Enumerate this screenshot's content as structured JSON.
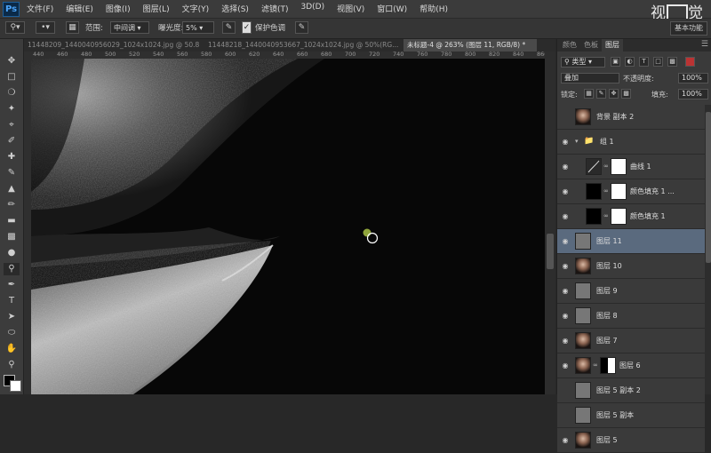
{
  "menubar": {
    "logo": "Ps",
    "items": [
      "文件(F)",
      "编辑(E)",
      "图像(I)",
      "图层(L)",
      "文字(Y)",
      "选择(S)",
      "滤镜(T)",
      "3D(D)",
      "视图(V)",
      "窗口(W)",
      "帮助(H)"
    ],
    "watermark_left": "视",
    "watermark_right": "觉"
  },
  "options": {
    "range_label": "范围:",
    "range_value": "中间调",
    "exposure_label": "曝光度:",
    "exposure_value": "5%",
    "protect_label": "保护色调",
    "workspace": "基本功能"
  },
  "tabs": [
    {
      "label": "11448209_1440040956029_1024x1024.jpg @ 50.8%..."
    },
    {
      "label": "11448218_1440040953667_1024x1024.jpg @ 50%(RG..."
    },
    {
      "label": "未标题-4 @ 263% (图层 11, RGB/8) *"
    }
  ],
  "ruler": [
    "440",
    "460",
    "480",
    "500",
    "520",
    "540",
    "560",
    "580",
    "600",
    "620",
    "640",
    "660",
    "680",
    "700",
    "720",
    "740",
    "760",
    "780",
    "800",
    "820",
    "840",
    "860"
  ],
  "panel": {
    "tabs": [
      "颜色",
      "色板",
      "图层"
    ],
    "filter_kind": "类型",
    "blend_mode": "叠加",
    "opacity_label": "不透明度:",
    "opacity_value": "100%",
    "lock_label": "锁定:",
    "fill_label": "填充:",
    "fill_value": "100%"
  },
  "layers": [
    {
      "name": "背景 副本 2",
      "visible": false,
      "thumb": "face",
      "mask": false,
      "indent": 0,
      "selected": false
    },
    {
      "name": "组 1",
      "visible": true,
      "thumb": "folder",
      "mask": false,
      "indent": 0,
      "selected": false
    },
    {
      "name": "曲线 1",
      "visible": true,
      "thumb": "curves",
      "mask": true,
      "indent": 1,
      "selected": false
    },
    {
      "name": "颜色填充 1 ...",
      "visible": true,
      "thumb": "black",
      "mask": true,
      "indent": 1,
      "selected": false
    },
    {
      "name": "颜色填充 1",
      "visible": true,
      "thumb": "black",
      "mask": true,
      "indent": 1,
      "selected": false
    },
    {
      "name": "图层 11",
      "visible": true,
      "thumb": "gray",
      "mask": false,
      "indent": 0,
      "selected": true
    },
    {
      "name": "图层 10",
      "visible": true,
      "thumb": "face",
      "mask": false,
      "indent": 0,
      "selected": false
    },
    {
      "name": "图层 9",
      "visible": true,
      "thumb": "gray",
      "mask": false,
      "indent": 0,
      "selected": false
    },
    {
      "name": "图层 8",
      "visible": true,
      "thumb": "gray",
      "mask": false,
      "indent": 0,
      "selected": false
    },
    {
      "name": "图层 7",
      "visible": true,
      "thumb": "face",
      "mask": false,
      "indent": 0,
      "selected": false
    },
    {
      "name": "图层 6",
      "visible": true,
      "thumb": "face",
      "mask": true,
      "indent": 0,
      "selected": false
    },
    {
      "name": "图层 5 副本 2",
      "visible": false,
      "thumb": "gray",
      "mask": false,
      "indent": 0,
      "selected": false
    },
    {
      "name": "图层 5 副本",
      "visible": false,
      "thumb": "gray",
      "mask": false,
      "indent": 0,
      "selected": false
    },
    {
      "name": "图层 5",
      "visible": true,
      "thumb": "face",
      "mask": false,
      "indent": 0,
      "selected": false
    }
  ],
  "colors": {
    "selected_layer": "#5a6a7e",
    "brush_marker": "#8fa43a"
  }
}
